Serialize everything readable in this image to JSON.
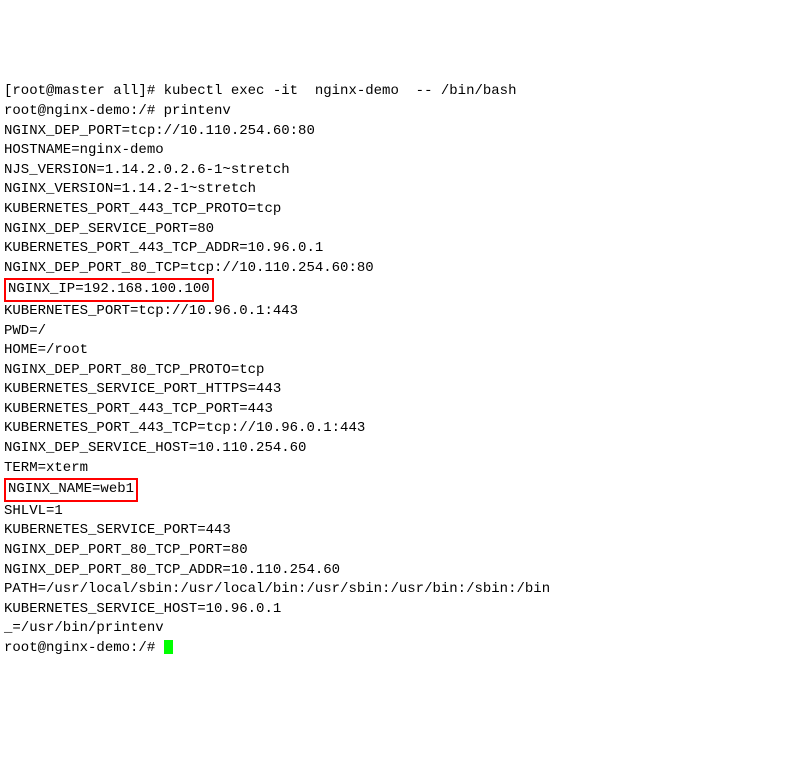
{
  "lines": [
    "[root@master all]# kubectl exec -it  nginx-demo  -- /bin/bash",
    "root@nginx-demo:/# printenv",
    "NGINX_DEP_PORT=tcp://10.110.254.60:80",
    "HOSTNAME=nginx-demo",
    "NJS_VERSION=1.14.2.0.2.6-1~stretch",
    "NGINX_VERSION=1.14.2-1~stretch",
    "KUBERNETES_PORT_443_TCP_PROTO=tcp",
    "NGINX_DEP_SERVICE_PORT=80",
    "KUBERNETES_PORT_443_TCP_ADDR=10.96.0.1",
    "NGINX_DEP_PORT_80_TCP=tcp://10.110.254.60:80"
  ],
  "highlight1": "NGINX_IP=192.168.100.100",
  "lines2": [
    "KUBERNETES_PORT=tcp://10.96.0.1:443",
    "PWD=/",
    "HOME=/root",
    "NGINX_DEP_PORT_80_TCP_PROTO=tcp",
    "KUBERNETES_SERVICE_PORT_HTTPS=443",
    "KUBERNETES_PORT_443_TCP_PORT=443",
    "KUBERNETES_PORT_443_TCP=tcp://10.96.0.1:443",
    "NGINX_DEP_SERVICE_HOST=10.110.254.60",
    "TERM=xterm"
  ],
  "highlight2": "NGINX_NAME=web1",
  "lines3": [
    "SHLVL=1",
    "KUBERNETES_SERVICE_PORT=443",
    "NGINX_DEP_PORT_80_TCP_PORT=80",
    "NGINX_DEP_PORT_80_TCP_ADDR=10.110.254.60",
    "PATH=/usr/local/sbin:/usr/local/bin:/usr/sbin:/usr/bin:/sbin:/bin",
    "KUBERNETES_SERVICE_HOST=10.96.0.1",
    "_=/usr/bin/printenv"
  ],
  "finalPrompt": "root@nginx-demo:/# "
}
